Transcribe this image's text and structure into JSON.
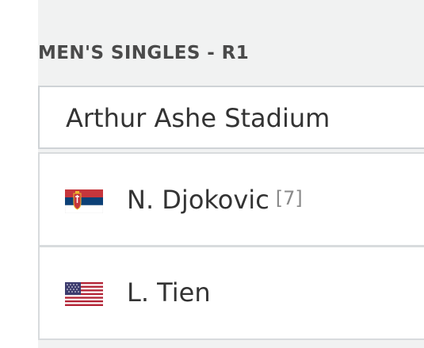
{
  "match": {
    "round_label": "MEN'S SINGLES - R1",
    "court": "Arthur Ashe Stadium"
  },
  "players": [
    {
      "name": "N. Djokovic",
      "seed": "[7]",
      "flag_icon": "serbia-flag-icon"
    },
    {
      "name": "L. Tien",
      "seed": "",
      "flag_icon": "usa-flag-icon"
    }
  ],
  "colors": {
    "panel_bg": "#f1f2f2",
    "border": "#cfd3d6",
    "text": "#333333",
    "heading": "#4a4a4a",
    "seed": "#8a8a8a"
  }
}
